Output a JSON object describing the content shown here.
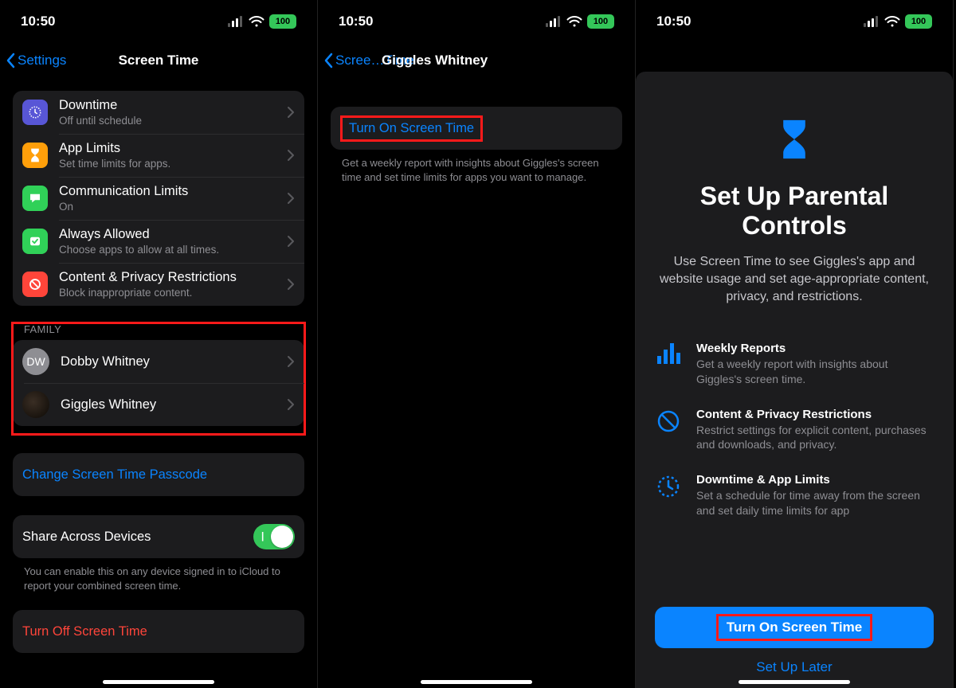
{
  "status": {
    "time": "10:50",
    "battery_text": "100"
  },
  "screen1": {
    "back_label": "Settings",
    "title": "Screen Time",
    "items": [
      {
        "title": "Downtime",
        "subtitle": "Off until schedule",
        "icon_color": "#5856d6"
      },
      {
        "title": "App Limits",
        "subtitle": "Set time limits for apps.",
        "icon_color": "#ff9f0a"
      },
      {
        "title": "Communication Limits",
        "subtitle": "On",
        "icon_color": "#30d158"
      },
      {
        "title": "Always Allowed",
        "subtitle": "Choose apps to allow at all times.",
        "icon_color": "#30d158"
      },
      {
        "title": "Content & Privacy Restrictions",
        "subtitle": "Block inappropriate content.",
        "icon_color": "#ff453a"
      }
    ],
    "family_header": "Family",
    "family": [
      {
        "initials": "DW",
        "name": "Dobby Whitney"
      },
      {
        "initials": "",
        "name": "Giggles Whitney"
      }
    ],
    "change_passcode": "Change Screen Time Passcode",
    "share_label": "Share Across Devices",
    "share_footer": "You can enable this on any device signed in to iCloud to report your combined screen time.",
    "turn_off": "Turn Off Screen Time"
  },
  "screen2": {
    "back_label": "Scree…Time",
    "title": "Giggles Whitney",
    "turn_on": "Turn On Screen Time",
    "footer": "Get a weekly report with insights about Giggles's screen time and set time limits for apps you want to manage."
  },
  "screen3": {
    "sheet_title": "Set Up Parental Controls",
    "sheet_desc": "Use Screen Time to see Giggles's app and website usage and set age-appropriate content, privacy, and restrictions.",
    "features": [
      {
        "title": "Weekly Reports",
        "sub": "Get a weekly report with insights about Giggles's screen time."
      },
      {
        "title": "Content & Privacy Restrictions",
        "sub": "Restrict settings for explicit content, purchases and downloads, and privacy."
      },
      {
        "title": "Downtime & App Limits",
        "sub": "Set a schedule for time away from the screen and set daily time limits for app"
      }
    ],
    "primary": "Turn On Screen Time",
    "later": "Set Up Later"
  }
}
